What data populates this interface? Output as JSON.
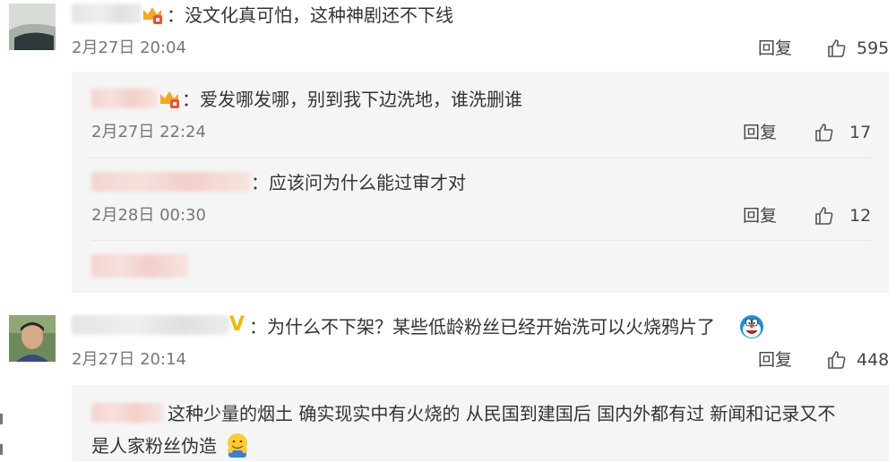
{
  "comments": [
    {
      "text": "：没文化真可怕，这种神剧还不下线",
      "time": "2月27日 20:04",
      "reply_label": "回复",
      "likes": "595"
    },
    {
      "text": "：为什么不下架？某些低龄粉丝已经开始洗可以火烧鸦片了",
      "time": "2月27日 20:14",
      "reply_label": "回复",
      "likes": "448"
    }
  ],
  "replies": [
    {
      "text": "：爱发哪发哪，别到我下边洗地，谁洗删谁",
      "time": "2月27日 22:24",
      "reply_label": "回复",
      "likes": "17"
    },
    {
      "text": "：应该问为什么能过审才对",
      "time": "2月28日 00:30",
      "reply_label": "回复",
      "likes": "12"
    },
    {
      "text_line1": "这种少量的烟土 确实现实中有火烧的 从民国到建国后 国内外都有过 新闻和记录又不",
      "text_line2": "是人家粉丝伪造"
    }
  ],
  "badges": {
    "v_badge": "V"
  },
  "colors": {
    "reply_bg": "#f5f5f5",
    "crown": "#f5a623",
    "v_badge": "#f5b800"
  },
  "icons": [
    "thumbs-up-icon",
    "crown-icon",
    "v-verified-icon",
    "doraemon-emoji",
    "hug-emoji"
  ]
}
